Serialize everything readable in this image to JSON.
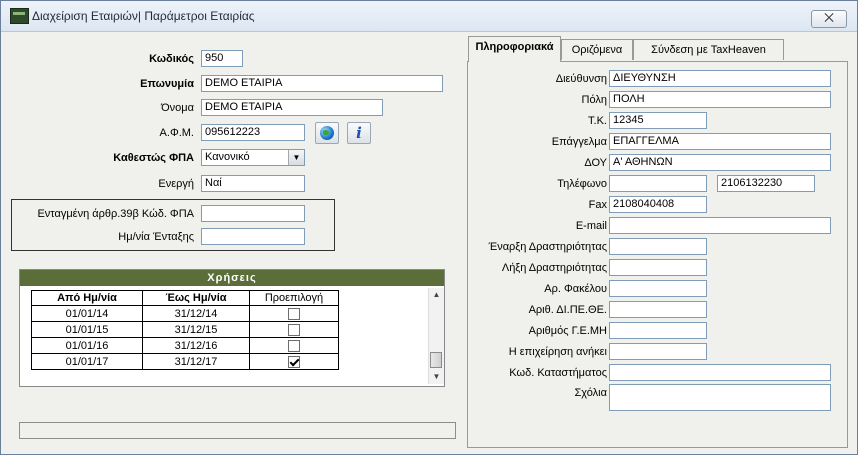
{
  "window": {
    "title": "Διαχείριση Εταιριών| Παράμετροι Εταιρίας",
    "close_label": "⨉"
  },
  "company": {
    "code_label": "Κωδικός",
    "code_value": "950",
    "name_label": "Επωνυμία",
    "name_value": "DEMO ΕΤΑΙΡΙΑ",
    "short_name_label": "Όνομα",
    "short_name_value": "DEMO ΕΤΑΙΡΙΑ",
    "afm_label": "Α.Φ.Μ.",
    "afm_value": "095612223",
    "vat_status_label": "Καθεστώς ΦΠΑ",
    "vat_status_value": "Κανονικό",
    "active_label": "Ενεργή",
    "active_value": "Ναί"
  },
  "art39": {
    "included_label": "Ενταγμένη άρθρ.39β Κώδ. ΦΠΑ",
    "included_value": "",
    "date_label": "Ημ/νία Ένταξης",
    "date_value": ""
  },
  "fiscal_years": {
    "title": "Χρήσεις",
    "columns": [
      "Από Ημ/νία",
      "Έως Ημ/νία",
      "Προεπιλογή"
    ],
    "rows": [
      {
        "from": "01/01/14",
        "to": "31/12/14",
        "default": false
      },
      {
        "from": "01/01/15",
        "to": "31/12/15",
        "default": false
      },
      {
        "from": "01/01/16",
        "to": "31/12/16",
        "default": false
      },
      {
        "from": "01/01/17",
        "to": "31/12/17",
        "default": true
      }
    ]
  },
  "tabs": [
    {
      "label": "Πληροφοριακά",
      "active": true
    },
    {
      "label": "Οριζόμενα",
      "active": false
    },
    {
      "label": "Σύνδεση με TaxHeaven",
      "active": false
    }
  ],
  "info": {
    "address_label": "Διεύθυνση",
    "address_value": "ΔΙΕΥΘΥΝΣΗ",
    "city_label": "Πόλη",
    "city_value": "ΠΟΛΗ",
    "zip_label": "Τ.Κ.",
    "zip_value": "12345",
    "profession_label": "Επάγγελμα",
    "profession_value": "ΕΠΑΓΓΕΛΜΑ",
    "tax_office_label": "ΔΟΥ",
    "tax_office_value": "Α' ΑΘΗΝΩΝ",
    "phone_label": "Τηλέφωνο",
    "phone1_value": "",
    "phone2_value": "2106132230",
    "fax_label": "Fax",
    "fax_value": "2108040408",
    "email_label": "E-mail",
    "email_value": "",
    "start_label": "Έναρξη Δραστηριότητας",
    "start_value": "",
    "end_label": "Λήξη Δραστηριότητας",
    "end_value": "",
    "folder_label": "Αρ. Φακέλου",
    "folder_value": "",
    "dipethe_label": "Αριθ. ΔΙ.ΠΕ.ΘΕ.",
    "dipethe_value": "",
    "gemi_label": "Αριθμός Γ.Ε.ΜΗ",
    "gemi_value": "",
    "belongs_label": "Η επιχείρηση ανήκει",
    "belongs_value": "",
    "store_label": "Κωδ. Καταστήματος",
    "store_value": "",
    "comments_label": "Σχόλια",
    "comments_value": ""
  }
}
